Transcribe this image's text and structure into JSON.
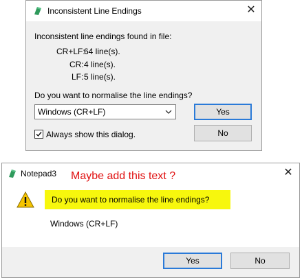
{
  "dialog1": {
    "title": "Inconsistent Line Endings",
    "heading": "Inconsistent line endings found in file:",
    "rows": [
      {
        "label": "CR+LF:",
        "value": "64 line(s)."
      },
      {
        "label": "CR:",
        "value": "4 line(s)."
      },
      {
        "label": "LF:",
        "value": "5 line(s)."
      }
    ],
    "question": "Do you want to normalise the line endings?",
    "select_value": "Windows (CR+LF)",
    "yes_label": "Yes",
    "no_label": "No",
    "checkbox_label": "Always show this dialog.",
    "checkbox_checked": true
  },
  "dialog2": {
    "title": "Notepad3",
    "annotation": "Maybe add this text ?",
    "question": "Do you want to normalise the line endings?",
    "detail": "Windows (CR+LF)",
    "yes_label": "Yes",
    "no_label": "No"
  },
  "colors": {
    "accent": "#2a7ad8",
    "highlight": "#f7f70d",
    "annotation": "#e01010",
    "warning": "#f5c400"
  }
}
